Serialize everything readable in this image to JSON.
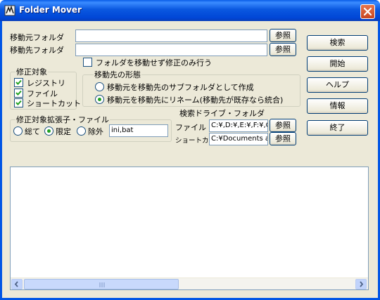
{
  "window": {
    "title": "Folder Mover"
  },
  "source": {
    "label": "移動元フォルダ",
    "value": "",
    "browse": "参照"
  },
  "dest": {
    "label": "移動先フォルダ",
    "value": "",
    "browse": "参照"
  },
  "fix_only": {
    "label": "フォルダを移動せず修正のみ行う",
    "checked": false
  },
  "targets": {
    "title": "修正対象",
    "items": [
      {
        "label": "レジストリ",
        "checked": true
      },
      {
        "label": "ファイル",
        "checked": true
      },
      {
        "label": "ショートカット",
        "checked": true
      }
    ]
  },
  "form": {
    "title": "移動先の形態",
    "options": [
      {
        "label": "移動元を移動先のサブフォルダとして作成",
        "selected": false
      },
      {
        "label": "移動元を移動先にリネーム(移動先が既存なら統合)",
        "selected": true
      }
    ]
  },
  "ext": {
    "title": "修正対象拡張子・ファイル",
    "options": [
      {
        "label": "総て",
        "selected": false
      },
      {
        "label": "限定",
        "selected": true
      },
      {
        "label": "除外",
        "selected": false
      }
    ],
    "value": "ini,bat"
  },
  "search": {
    "title": "検索ドライブ・フォルダ",
    "file_label": "ファイル",
    "file_value": "C:¥,D:¥,E:¥,F:¥,G",
    "shortcut_label": "ショートカット",
    "shortcut_value": "C:¥Documents a",
    "browse": "参照"
  },
  "buttons": {
    "search": "検索",
    "start": "開始",
    "help": "ヘルプ",
    "info": "情報",
    "exit": "終了"
  },
  "colors": {
    "titlebar": "#0054e3",
    "face": "#ece9d8",
    "close": "#d8542b",
    "border": "#7f9db9"
  }
}
